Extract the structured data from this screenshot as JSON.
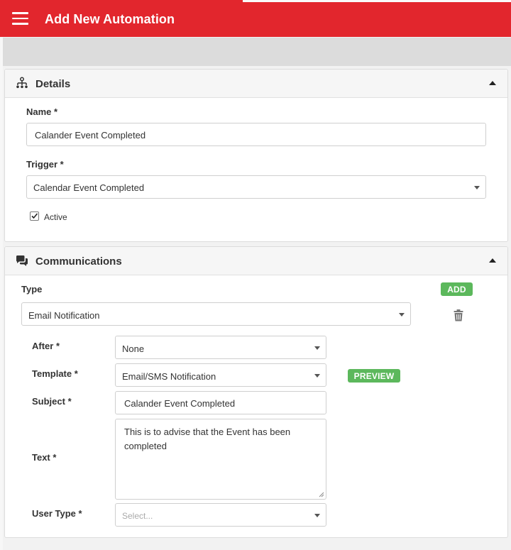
{
  "header": {
    "title": "Add New Automation",
    "menu_icon": "hamburger-menu-icon"
  },
  "details": {
    "title": "Details",
    "icon": "sitemap-icon",
    "name_label": "Name *",
    "name_value": "Calander Event Completed",
    "trigger_label": "Trigger *",
    "trigger_value": "Calendar Event Completed",
    "active_label": "Active",
    "active_checked": true
  },
  "communications": {
    "title": "Communications",
    "icon": "chat-bubbles-icon",
    "type_label": "Type",
    "add_label": "ADD",
    "type_value": "Email Notification",
    "after_label": "After *",
    "after_value": "None",
    "template_label": "Template *",
    "template_value": "Email/SMS Notification",
    "preview_label": "PREVIEW",
    "subject_label": "Subject *",
    "subject_value": "Calander Event Completed",
    "text_label": "Text *",
    "text_value": "This is to advise that the Event has been completed",
    "user_type_label": "User Type *",
    "user_type_placeholder": "Select..."
  },
  "colors": {
    "brand_red": "#e2262d",
    "green": "#5cb85c"
  }
}
